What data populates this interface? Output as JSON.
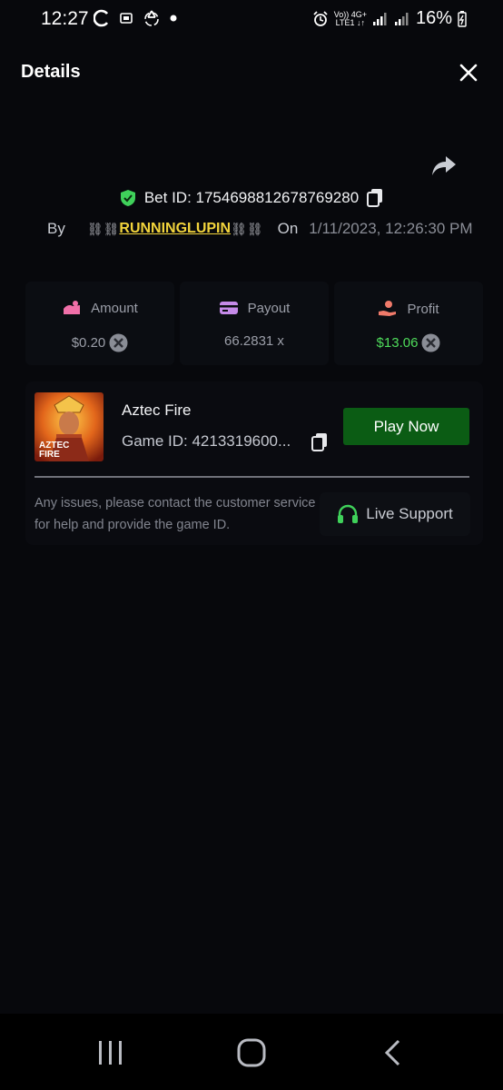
{
  "status_bar": {
    "time": "12:27",
    "net_top": "Vo)) 4G+",
    "net_bottom": "LTE1 ↓↑",
    "battery": "16%"
  },
  "header": {
    "title": "Details"
  },
  "bet": {
    "id_text": "Bet ID: 1754698812678769280",
    "by_label": "By",
    "chain_left": "⛓⛓",
    "username": "RUNNINGLUPIN",
    "chain_right": "⛓⛓",
    "on_label": "On",
    "date": "1/11/2023, 12:26:30 PM"
  },
  "stats": {
    "amount_label": "Amount",
    "amount_value": "$0.20",
    "payout_label": "Payout",
    "payout_value": "66.2831 x",
    "profit_label": "Profit",
    "profit_value": "$13.06"
  },
  "game": {
    "name": "Aztec Fire",
    "id_text": "Game ID: 4213319600...",
    "thumb_title_line1": "AZTEC",
    "thumb_title_line2": "FIRE",
    "play_label": "Play Now",
    "help_text": "Any issues, please contact the customer service for help and provide the game ID.",
    "support_label": "Live Support"
  },
  "colors": {
    "background": "#07080c",
    "accent_green": "#0b5c14",
    "profit_green": "#4fdc5b",
    "username_yellow": "#f2d43c"
  }
}
